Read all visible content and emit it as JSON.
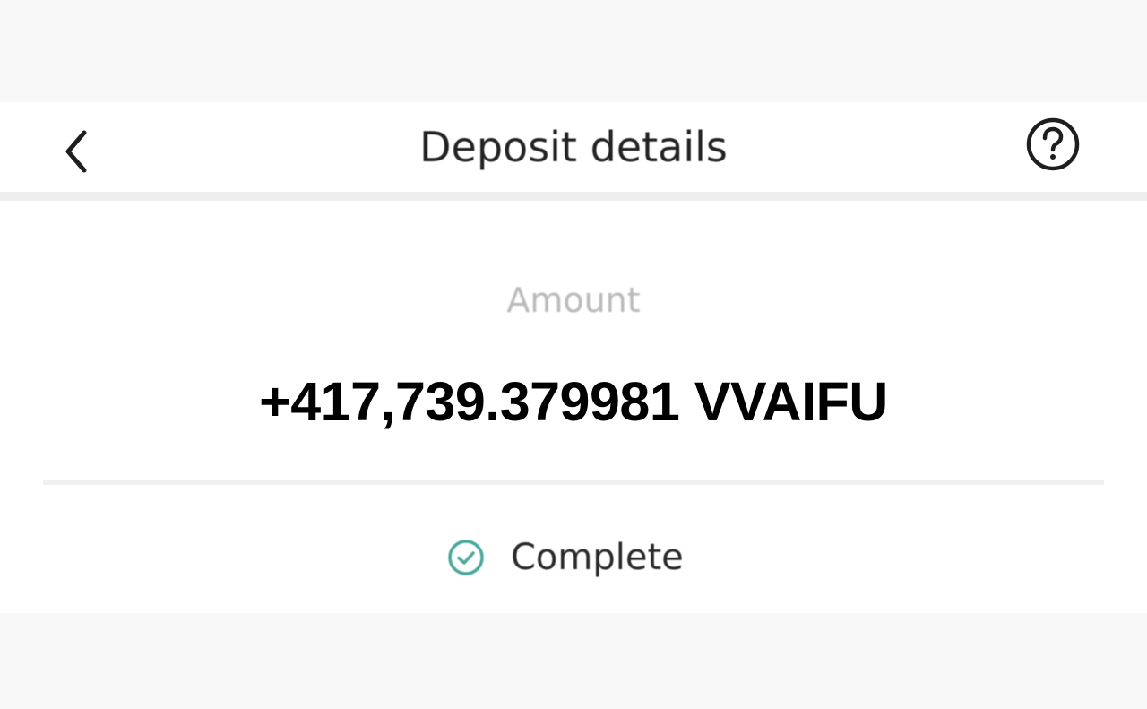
{
  "header": {
    "title": "Deposit details",
    "back_icon": "chevron-left-icon",
    "help_icon": "question-circle-icon"
  },
  "deposit": {
    "amount_label": "Amount",
    "amount_value": "+417,739.379981 VVAIFU",
    "status_text": "Complete",
    "status_icon": "check-circle-icon",
    "status_color": "#4aa89a"
  }
}
